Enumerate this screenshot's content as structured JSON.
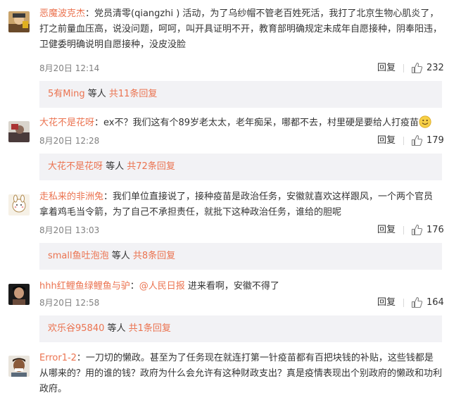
{
  "comments": [
    {
      "username": "恶魔波克杰",
      "text": "：党员清零(qiangzhi ) 活动，为了乌纱帽不管老百姓死活，我打了北京生物心肌炎了，打之前量血压高，说没问题，呵呵，叫开具证明不开，教育部明确规定未成年自愿接种，阴奉阳违，卫健委明确说明自愿接种，没皮没脸",
      "time": "8月20日 12:14",
      "reply": "回复",
      "likes": "232",
      "sub": {
        "name": "5有Ming",
        "mid": " 等人 ",
        "count": "共11条回复"
      }
    },
    {
      "username": "大花不是花呀",
      "text": "：ex不？我们这有个89岁老太太，老年痴呆，哪都不去，村里硬是要给人打疫苗",
      "emoji": "smile-emoji",
      "time": "8月20日 12:28",
      "reply": "回复",
      "likes": "179",
      "sub": {
        "name": "大花不是花呀",
        "mid": " 等人 ",
        "count": "共72条回复"
      }
    },
    {
      "username": "走私来的非洲兔",
      "text": "：我们单位直接说了，接种疫苗是政治任务，安徽就喜欢这样跟风，一个两个官员拿着鸡毛当令箭，为了自己不承担责任，就批下这种政治任务，谁给的胆呢",
      "time": "8月20日 13:03",
      "reply": "回复",
      "likes": "176",
      "sub": {
        "name": "small鱼吐泡泡",
        "mid": " 等人 ",
        "count": "共8条回复"
      }
    },
    {
      "username": "hhh红鲤鱼绿鲤鱼与驴",
      "text_pre": "：",
      "mention": "@人民日报",
      "text": " 进来看啊，安徽不得了",
      "time": "8月20日 12:58",
      "reply": "回复",
      "likes": "164",
      "sub": {
        "name": "欢乐谷95840",
        "mid": " 等人 ",
        "count": "共1条回复"
      }
    },
    {
      "username": "Error1-2",
      "text": "：一刀切的懒政。甚至为了任务现在就连打第一针疫苗都有百把块钱的补贴，这些钱都是从哪来的？用的谁的钱？政府为什么会允许有这种财政支出？真是疫情表现出个别政府的懒政和功利政府。"
    }
  ],
  "colors": {
    "link": "#eb7350",
    "text": "#333333",
    "meta": "#808080",
    "subbox": "#f2f2f5"
  }
}
